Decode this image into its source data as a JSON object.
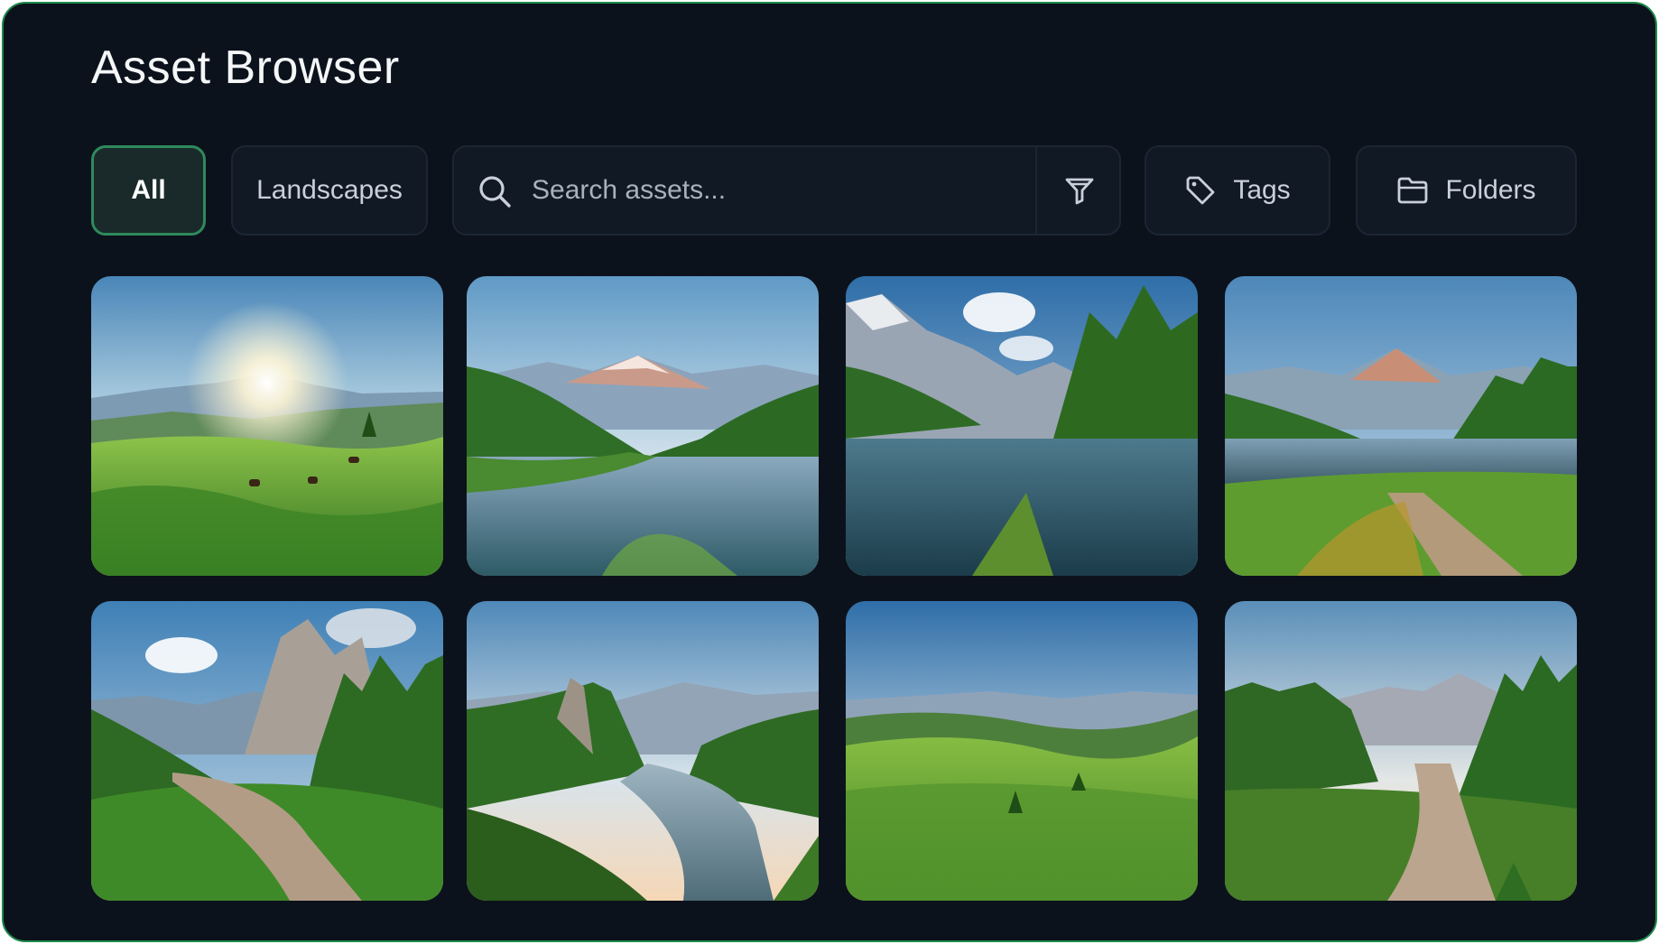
{
  "header": {
    "title": "Asset Browser"
  },
  "filters": {
    "all_label": "All",
    "landscapes_label": "Landscapes",
    "tags_label": "Tags",
    "folders_label": "Folders",
    "active": "All"
  },
  "search": {
    "placeholder": "Search assets..."
  },
  "icons": {
    "search": "search-icon",
    "filter": "filter-icon",
    "tag": "tag-icon",
    "folder": "folder-icon"
  },
  "colors": {
    "background": "#0c121c",
    "border_accent": "#1f8a4d",
    "active_chip_border": "#2e8a5c"
  },
  "gallery": {
    "items": [
      {
        "scene": "sunrise-meadow-grazing"
      },
      {
        "scene": "mountain-lake-valley"
      },
      {
        "scene": "alpine-lake-pines"
      },
      {
        "scene": "peak-river-path"
      },
      {
        "scene": "rocky-peaks-trail"
      },
      {
        "scene": "river-cliff-valley"
      },
      {
        "scene": "green-rolling-hills"
      },
      {
        "scene": "forest-trail-mountains"
      }
    ]
  }
}
